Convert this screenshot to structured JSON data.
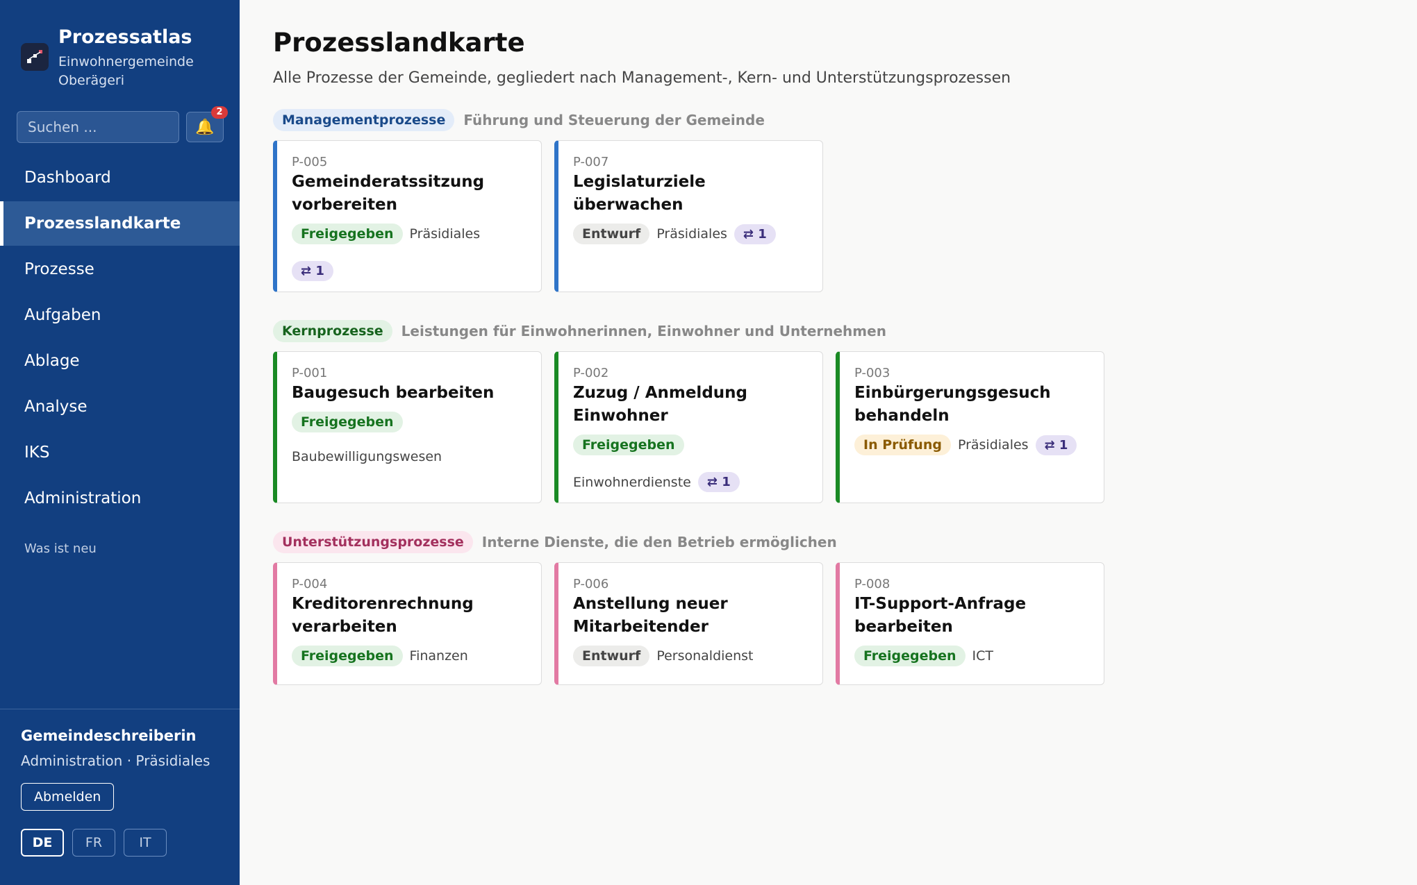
{
  "app": {
    "title": "Prozessatlas",
    "subtitle": "Einwohnergemeinde Oberägeri"
  },
  "search": {
    "placeholder": "Suchen ..."
  },
  "notifications": {
    "count": "2"
  },
  "nav": {
    "items": [
      {
        "label": "Dashboard",
        "active": false
      },
      {
        "label": "Prozesslandkarte",
        "active": true
      },
      {
        "label": "Prozesse",
        "active": false
      },
      {
        "label": "Aufgaben",
        "active": false
      },
      {
        "label": "Ablage",
        "active": false
      },
      {
        "label": "Analyse",
        "active": false
      },
      {
        "label": "IKS",
        "active": false
      },
      {
        "label": "Administration",
        "active": false
      }
    ],
    "whats_new": "Was ist neu"
  },
  "user": {
    "name": "Gemeindeschreiberin",
    "role": "Administration · Präsidiales",
    "logout_label": "Abmelden"
  },
  "languages": [
    {
      "code": "DE",
      "active": true
    },
    {
      "code": "FR",
      "active": false
    },
    {
      "code": "IT",
      "active": false
    }
  ],
  "page": {
    "title": "Prozesslandkarte",
    "subtitle": "Alle Prozesse der Gemeinde, gegliedert nach Management-, Kern- und Unterstützungsprozessen"
  },
  "sections": [
    {
      "label": "Managementprozesse",
      "description": "Führung und Steuerung der Gemeinde",
      "colors": {
        "pill_bg": "#e3ecf9",
        "pill_text": "#1a4a8a",
        "accent": "#2f74c8"
      },
      "cards": [
        {
          "id": "P-005",
          "title": "Gemeinderatssitzung vorbereiten",
          "status": "Freigegeben",
          "status_kind": "freigegeben",
          "department": "Präsidiales",
          "links": "⇄ 1",
          "links_wrap": true
        },
        {
          "id": "P-007",
          "title": "Legislaturziele überwachen",
          "status": "Entwurf",
          "status_kind": "entwurf",
          "department": "Präsidiales",
          "links": "⇄ 1",
          "links_wrap": false
        }
      ]
    },
    {
      "label": "Kernprozesse",
      "description": "Leistungen für Einwohnerinnen, Einwohner und Unternehmen",
      "colors": {
        "pill_bg": "#e2f2e4",
        "pill_text": "#16631d",
        "accent": "#1a8a24"
      },
      "cards": [
        {
          "id": "P-001",
          "title": "Baugesuch bearbeiten",
          "status": "Freigegeben",
          "status_kind": "freigegeben",
          "department": "Baubewilligungswesen",
          "links": "",
          "dept_wrap": true
        },
        {
          "id": "P-002",
          "title": "Zuzug / Anmeldung Einwohner",
          "status": "Freigegeben",
          "status_kind": "freigegeben",
          "department": "Einwohnerdienste",
          "links": "⇄ 1",
          "dept_wrap": true
        },
        {
          "id": "P-003",
          "title": "Einbürgerungsgesuch behandeln",
          "status": "In Prüfung",
          "status_kind": "pruefung",
          "department": "Präsidiales",
          "links": "⇄ 1"
        }
      ]
    },
    {
      "label": "Unterstützungsprozesse",
      "description": "Interne Dienste, die den Betrieb ermöglichen",
      "colors": {
        "pill_bg": "#fbe6ee",
        "pill_text": "#a3305d",
        "accent": "#e27aa3"
      },
      "cards": [
        {
          "id": "P-004",
          "title": "Kreditorenrechnung verarbeiten",
          "status": "Freigegeben",
          "status_kind": "freigegeben",
          "department": "Finanzen",
          "links": ""
        },
        {
          "id": "P-006",
          "title": "Anstellung neuer Mitarbeitender",
          "status": "Entwurf",
          "status_kind": "entwurf",
          "department": "Personaldienst",
          "links": ""
        },
        {
          "id": "P-008",
          "title": "IT-Support-Anfrage bearbeiten",
          "status": "Freigegeben",
          "status_kind": "freigegeben",
          "department": "ICT",
          "links": ""
        }
      ]
    }
  ]
}
